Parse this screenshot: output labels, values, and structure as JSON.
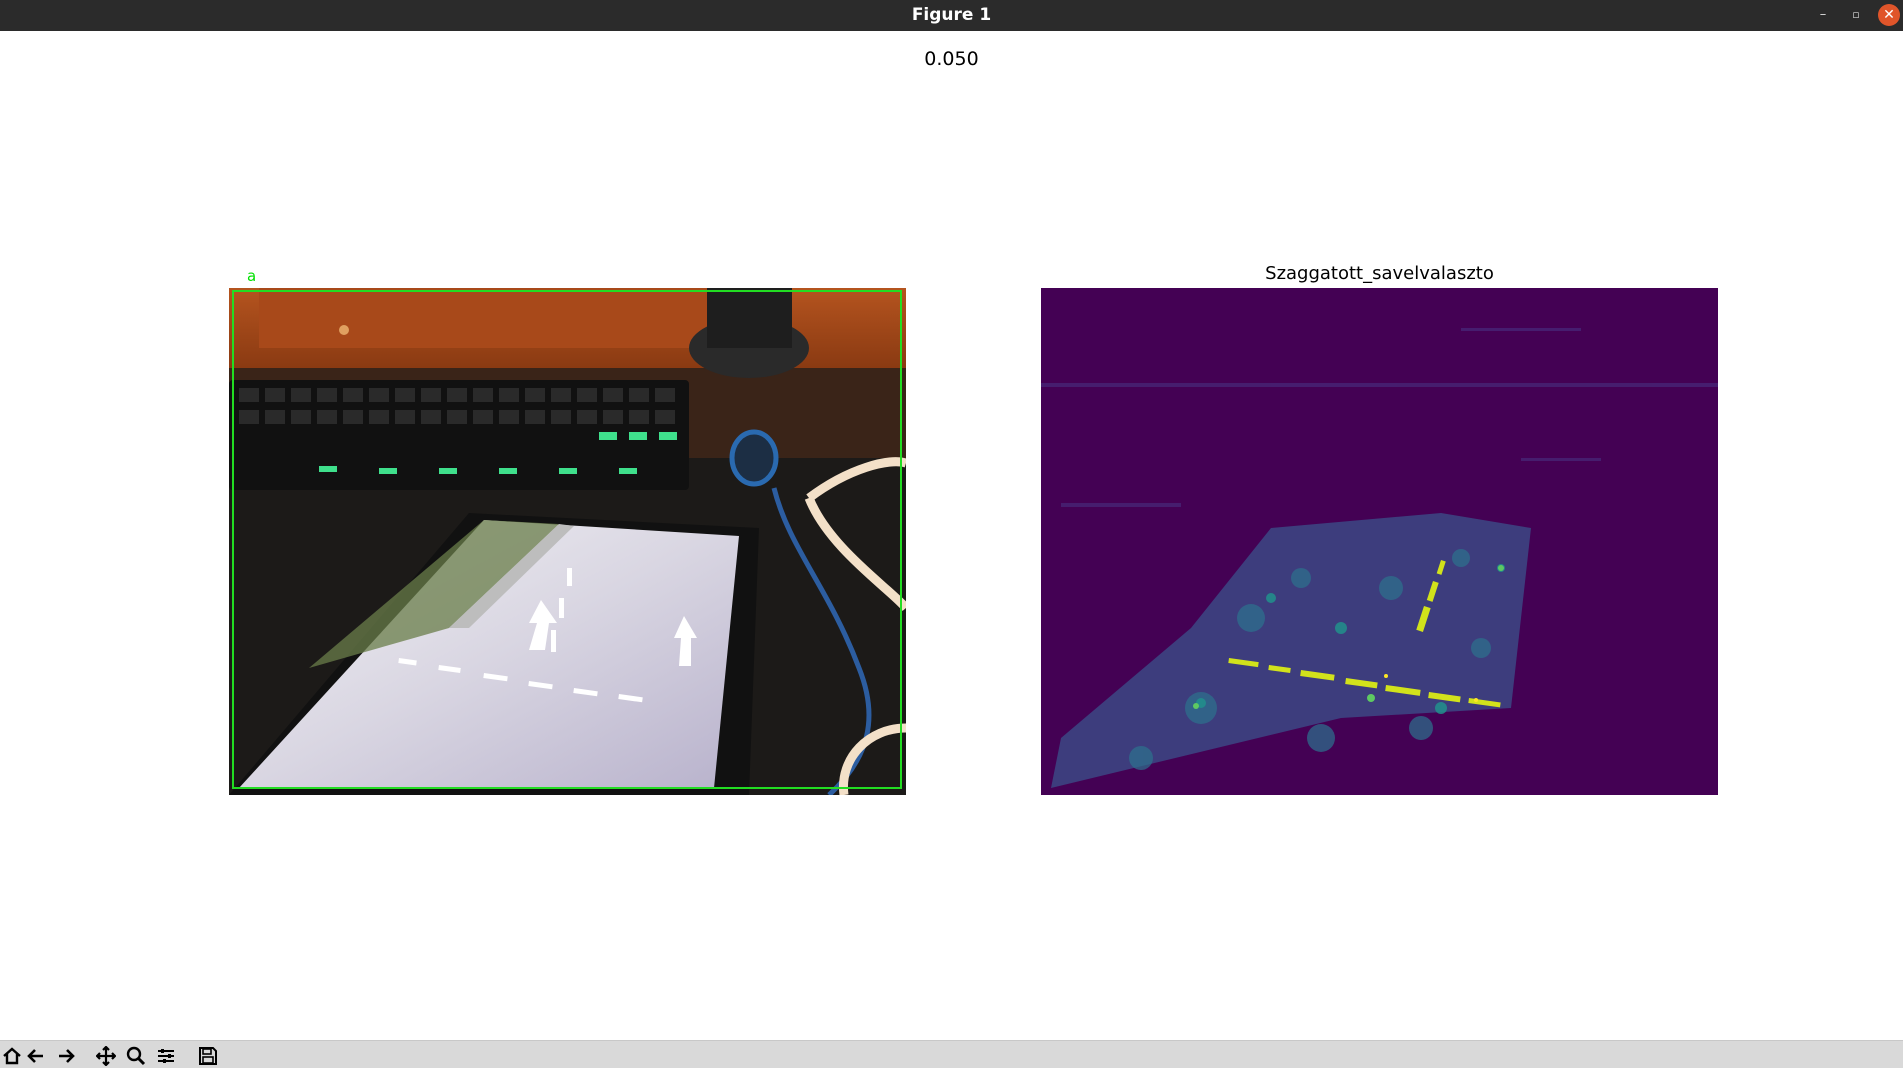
{
  "window": {
    "title": "Figure 1",
    "minimize_glyph": "–",
    "maximize_glyph": "▫",
    "close_glyph": "✕"
  },
  "figure": {
    "suptitle": "0.050",
    "left_axes": {
      "title": "",
      "detection_label": "a",
      "box_color": "#22dd22"
    },
    "right_axes": {
      "title": "Szaggatott_savelvalaszto",
      "colormap": "viridis"
    }
  },
  "toolbar": {
    "buttons": [
      {
        "name": "home-icon"
      },
      {
        "name": "back-arrow-icon"
      },
      {
        "name": "forward-arrow-icon"
      },
      {
        "name": "pan-icon"
      },
      {
        "name": "zoom-icon"
      },
      {
        "name": "configure-subplots-icon"
      },
      {
        "name": "save-icon"
      }
    ]
  }
}
